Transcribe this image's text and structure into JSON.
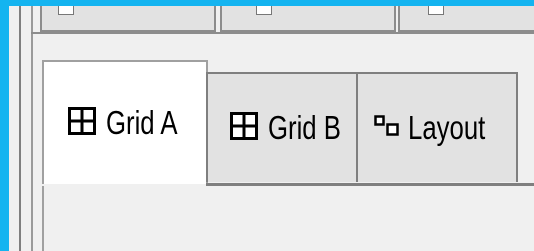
{
  "top_tabs": [
    {
      "label": ""
    },
    {
      "label": ""
    },
    {
      "label": ""
    }
  ],
  "tabs": [
    {
      "label": "Grid A",
      "icon": "grid-icon",
      "active": true
    },
    {
      "label": "Grid B",
      "icon": "grid-icon",
      "active": false
    },
    {
      "label": "Layout",
      "icon": "layout-icon",
      "active": false
    }
  ],
  "colors": {
    "frame_accent": "#14b4f0",
    "border": "#7f7f7f",
    "tab_inactive": "#e2e2e2",
    "tab_active": "#ffffff",
    "panel": "#f0f0f0"
  }
}
